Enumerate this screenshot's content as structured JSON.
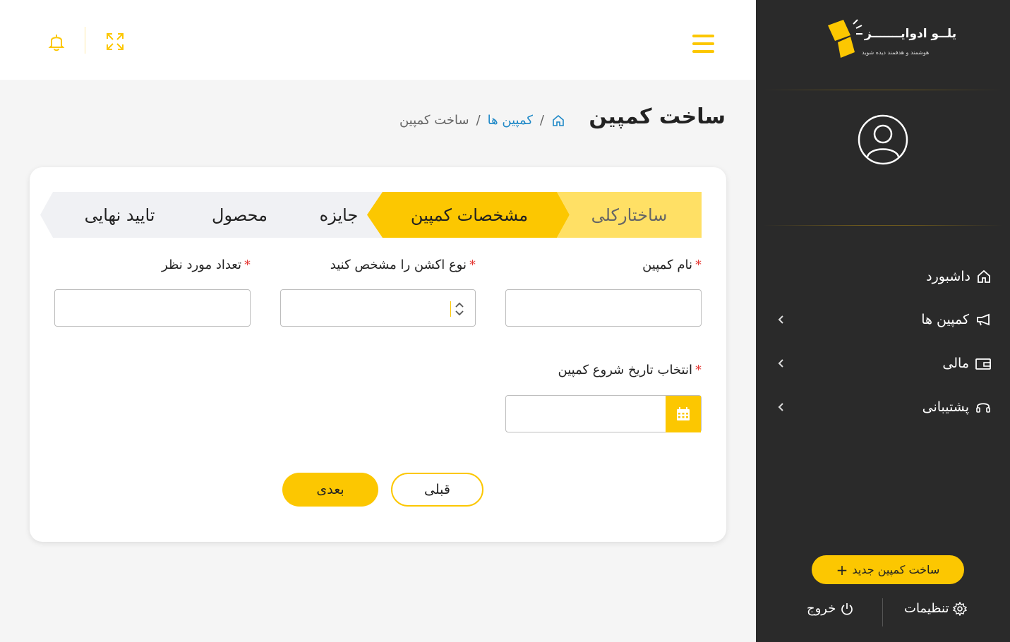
{
  "brand": {
    "name": "یلــو ادوایـــــــز",
    "tagline": "هوشمند و هدفمند دیده شوید",
    "accent": "#fcc701"
  },
  "sidebar": {
    "items": [
      {
        "label": "داشبورد",
        "icon": "home-icon",
        "has_submenu": false
      },
      {
        "label": "کمپین ها",
        "icon": "megaphone-icon",
        "has_submenu": true
      },
      {
        "label": "مالی",
        "icon": "wallet-icon",
        "has_submenu": true
      },
      {
        "label": "پشتیبانی",
        "icon": "headset-icon",
        "has_submenu": true
      }
    ],
    "new_campaign_label": "ساخت کمپین جدید",
    "settings_label": "تنظیمات",
    "logout_label": "خروج"
  },
  "page": {
    "title": "ساخت کمپین",
    "breadcrumb": [
      "کمپین ها",
      "ساخت کمپین"
    ]
  },
  "wizard": {
    "steps": [
      {
        "label": "ساختارکلی",
        "state": "completed"
      },
      {
        "label": "مشخصات کمپین",
        "state": "active"
      },
      {
        "label": "جایزه",
        "state": "pending"
      },
      {
        "label": "محصول",
        "state": "pending"
      },
      {
        "label": "تایید نهایی",
        "state": "pending"
      }
    ]
  },
  "form": {
    "campaign_name_label": "نام کمپین",
    "action_type_label": "نوع اکشن را مشخص کنید",
    "count_label": "تعداد مورد نظر",
    "start_date_label": "انتخاب تاریخ شروع کمپین",
    "campaign_name_value": "",
    "action_type_value": "",
    "count_value": "",
    "start_date_value": "",
    "required_mark": "*"
  },
  "buttons": {
    "next_label": "بعدی",
    "prev_label": "قبلی"
  }
}
